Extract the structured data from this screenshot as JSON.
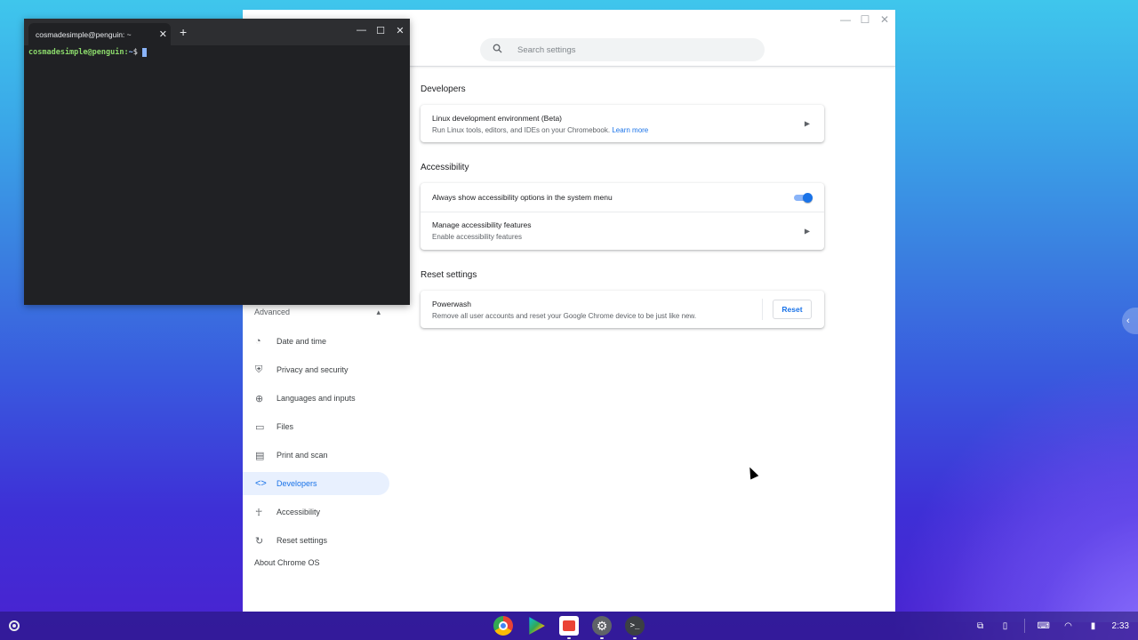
{
  "settings": {
    "window_controls": [
      "—",
      "☐",
      "✕"
    ],
    "search": {
      "placeholder": "Search settings"
    },
    "sidebar": {
      "advanced_label": "Advanced",
      "advanced_chevron": "▴",
      "items": [
        {
          "label": "Date and time",
          "icon": "clock-icon",
          "glyph": "◔"
        },
        {
          "label": "Privacy and security",
          "icon": "shield-icon",
          "glyph": "⛨"
        },
        {
          "label": "Languages and inputs",
          "icon": "globe-icon",
          "glyph": "⊕"
        },
        {
          "label": "Files",
          "icon": "folder-icon",
          "glyph": "▭"
        },
        {
          "label": "Print and scan",
          "icon": "printer-icon",
          "glyph": "▤"
        },
        {
          "label": "Developers",
          "icon": "code-icon",
          "glyph": "<>"
        },
        {
          "label": "Accessibility",
          "icon": "accessibility-icon",
          "glyph": "☥"
        },
        {
          "label": "Reset settings",
          "icon": "restore-icon",
          "glyph": "↻"
        }
      ],
      "active_item": "Developers",
      "about": "About Chrome OS"
    },
    "developers": {
      "title": "Developers",
      "linux": {
        "title": "Linux development environment (Beta)",
        "subtitle": "Run Linux tools, editors, and IDEs on your Chromebook.",
        "link": "Learn more"
      }
    },
    "accessibility": {
      "title": "Accessibility",
      "always_show": {
        "title": "Always show accessibility options in the system menu",
        "enabled": true
      },
      "manage": {
        "title": "Manage accessibility features",
        "subtitle": "Enable accessibility features"
      }
    },
    "reset": {
      "title": "Reset settings",
      "powerwash": {
        "title": "Powerwash",
        "subtitle": "Remove all user accounts and reset your Google Chrome device to be just like new.",
        "button": "Reset"
      }
    }
  },
  "terminal": {
    "tab_title": "cosmadesimple@penguin: ~",
    "tab_close": "✕",
    "new_tab": "+",
    "window_controls": [
      "—",
      "☐",
      "✕"
    ],
    "prompt_user": "cosmadesimple@penguin",
    "prompt_sep": ":",
    "prompt_path": "~",
    "prompt_symbol": "$"
  },
  "shelf": {
    "apps": [
      "Chrome",
      "Play Store",
      "Files",
      "Settings",
      "Terminal"
    ],
    "time": "2:33"
  }
}
